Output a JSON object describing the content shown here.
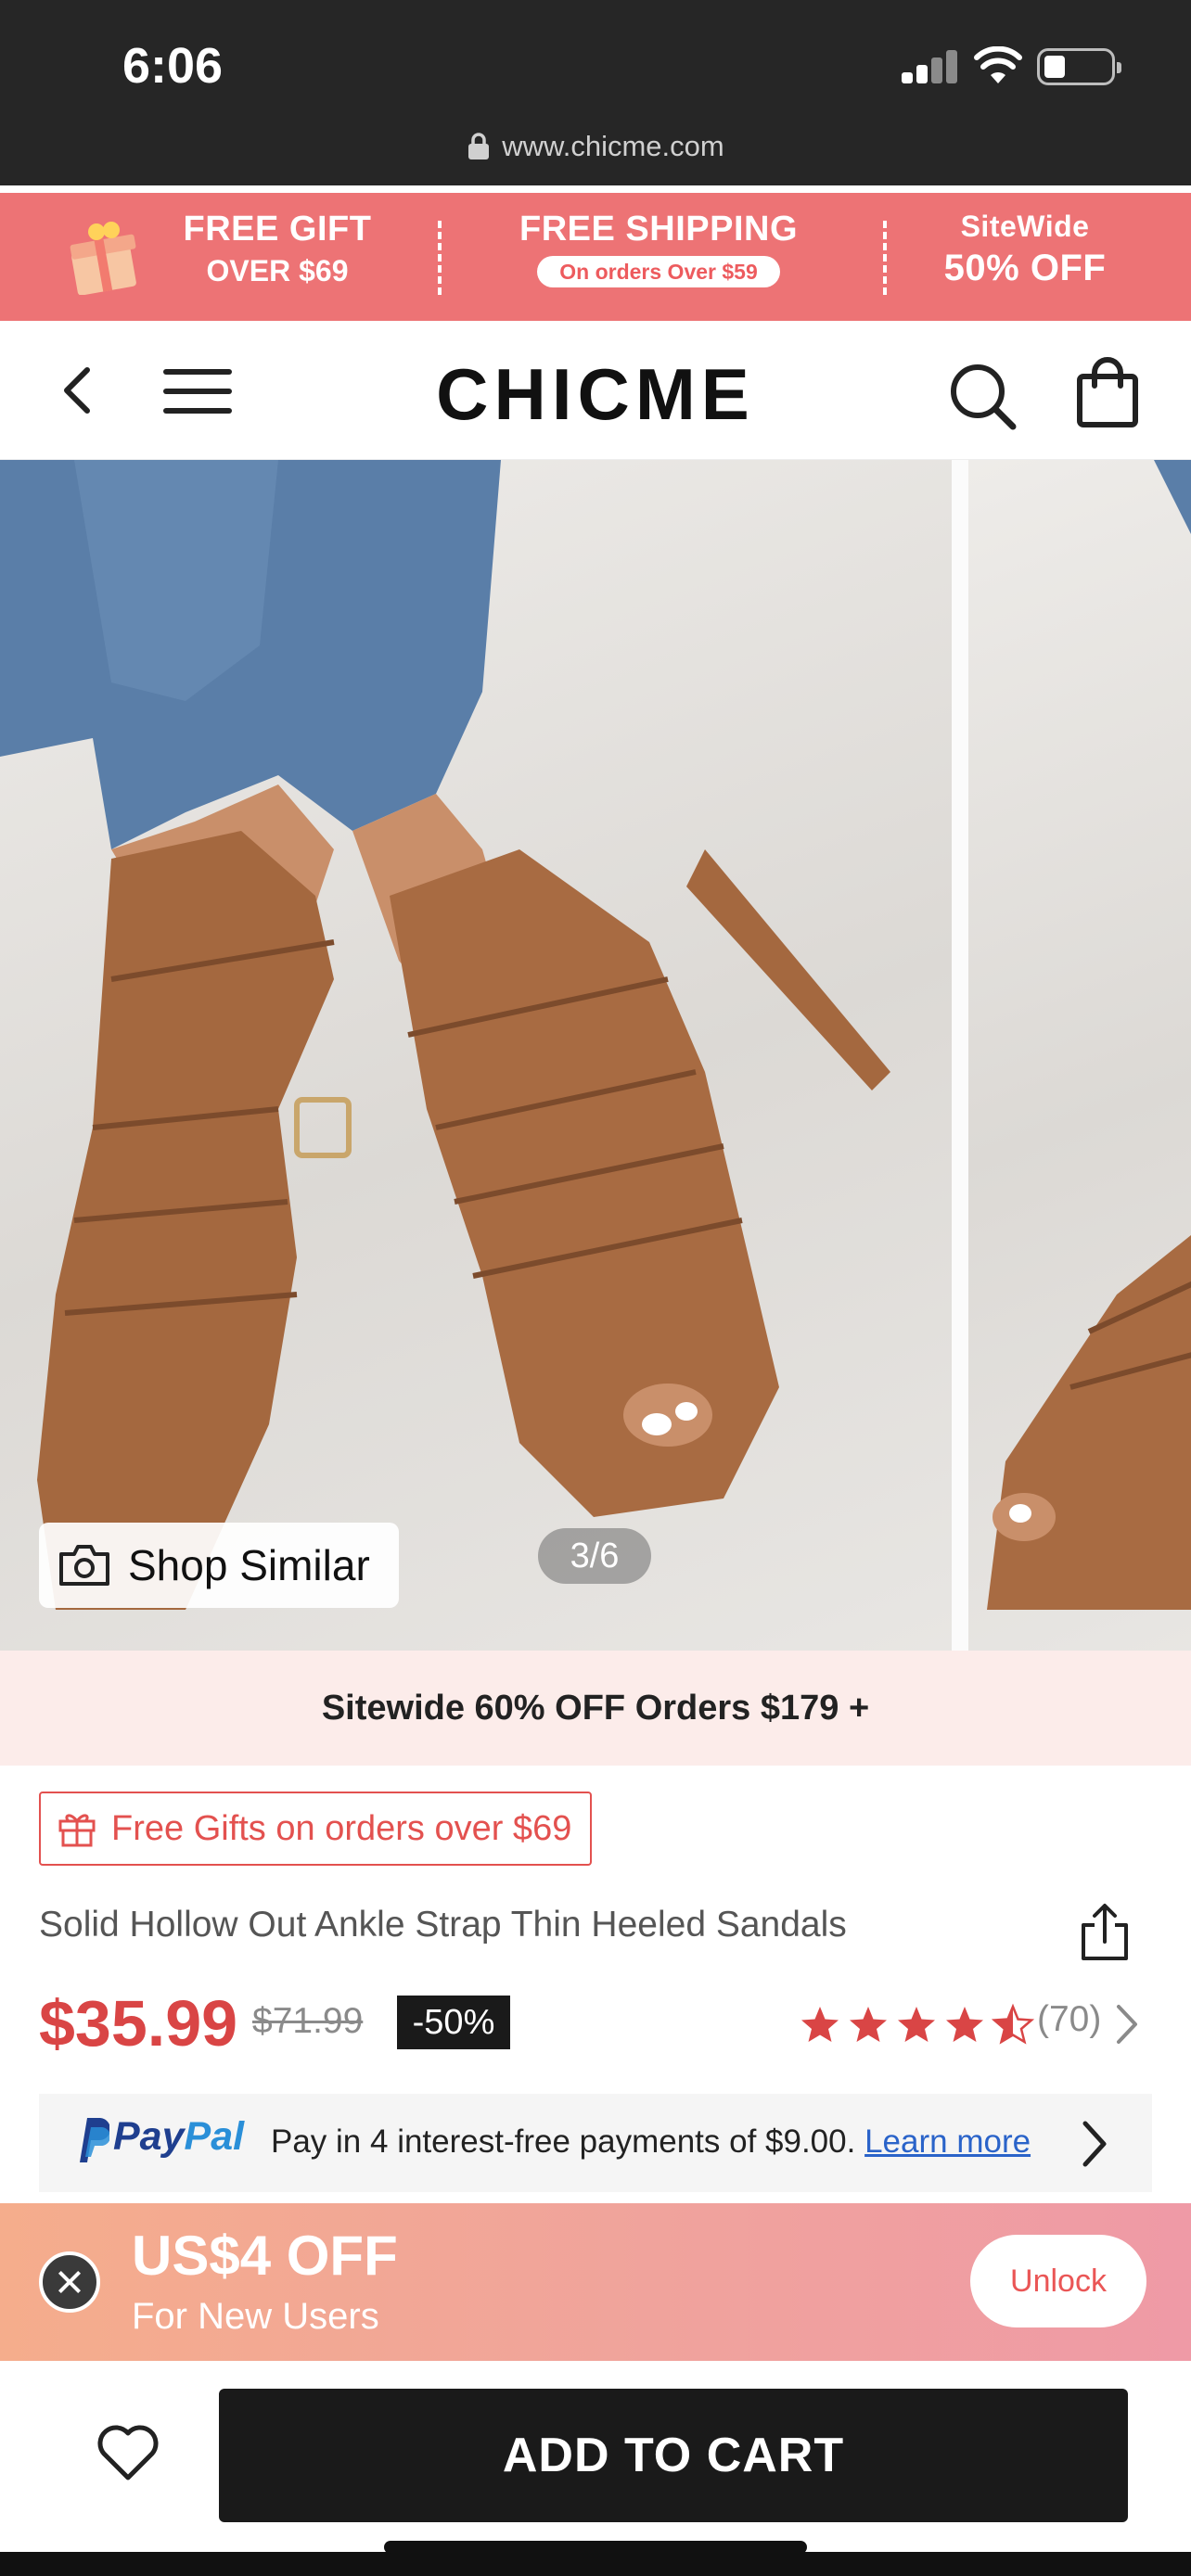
{
  "status_bar": {
    "time": "6:06",
    "url": "www.chicme.com"
  },
  "promo_banner": {
    "gift_title": "FREE GIFT",
    "gift_sub": "OVER $69",
    "shipping_title": "FREE SHIPPING",
    "shipping_sub": "On orders Over $59",
    "sitewide_title": "SiteWide",
    "sitewide_sub": "50% OFF",
    "accent_color": "#ed7375"
  },
  "header": {
    "logo": "CHICME",
    "icons": [
      "chevron-left-icon",
      "menu-icon",
      "search-icon",
      "shopping-bag-icon"
    ]
  },
  "gallery": {
    "shop_similar_label": "Shop Similar",
    "counter": "3/6"
  },
  "sitewide_strip": {
    "text": "Sitewide 60% OFF Orders $179 +"
  },
  "product": {
    "free_gifts_label": "Free Gifts on orders over $69",
    "title": "Solid Hollow Out Ankle Strap Thin Heeled Sandals",
    "price": "$35.99",
    "original_price": "$71.99",
    "discount": "-50%",
    "rating": 4.5,
    "review_count": "(70)",
    "price_color": "#d94545"
  },
  "paypal": {
    "brand_pay": "Pay",
    "brand_pal": "Pal",
    "text": "Pay in 4 interest-free payments of $9.00.",
    "link": "Learn more"
  },
  "new_user_bar": {
    "amount": "US$4 OFF",
    "subtitle": "For New Users",
    "unlock_label": "Unlock"
  },
  "bottom_bar": {
    "add_to_cart_label": "ADD TO CART"
  }
}
